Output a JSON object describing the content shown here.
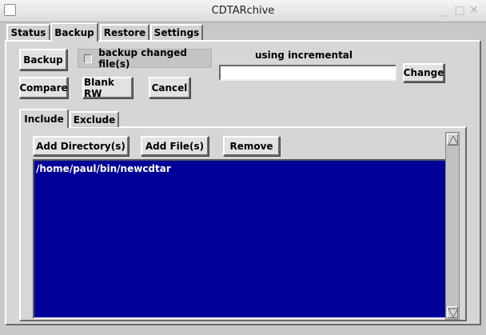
{
  "window": {
    "title": "CDTARchive",
    "controls": {
      "minimize_icon": "minimize-icon",
      "maximize_icon": "maximize-icon",
      "close_icon": "close-icon"
    }
  },
  "main_tabs": [
    {
      "label": "Status",
      "active": false
    },
    {
      "label": "Backup",
      "active": true
    },
    {
      "label": "Restore",
      "active": false
    },
    {
      "label": "Settings",
      "active": false
    }
  ],
  "backup": {
    "backup_button": "Backup",
    "checkbox_label": "backup changed file(s)",
    "checkbox_checked": false,
    "incremental_label": "using incremental",
    "incremental_value": "",
    "change_button": "Change",
    "compare_button": "Compare",
    "blank_rw_button": "Blank RW",
    "cancel_button": "Cancel"
  },
  "sub_tabs": [
    {
      "label": "Include",
      "active": true
    },
    {
      "label": "Exclude",
      "active": false
    }
  ],
  "include": {
    "add_directory_button": "Add Directory(s)",
    "add_files_button": "Add File(s)",
    "remove_button": "Remove",
    "items": [
      "/home/paul/bin/newcdtar"
    ]
  },
  "colors": {
    "list_background": "#000099",
    "list_text": "#ffffff"
  }
}
